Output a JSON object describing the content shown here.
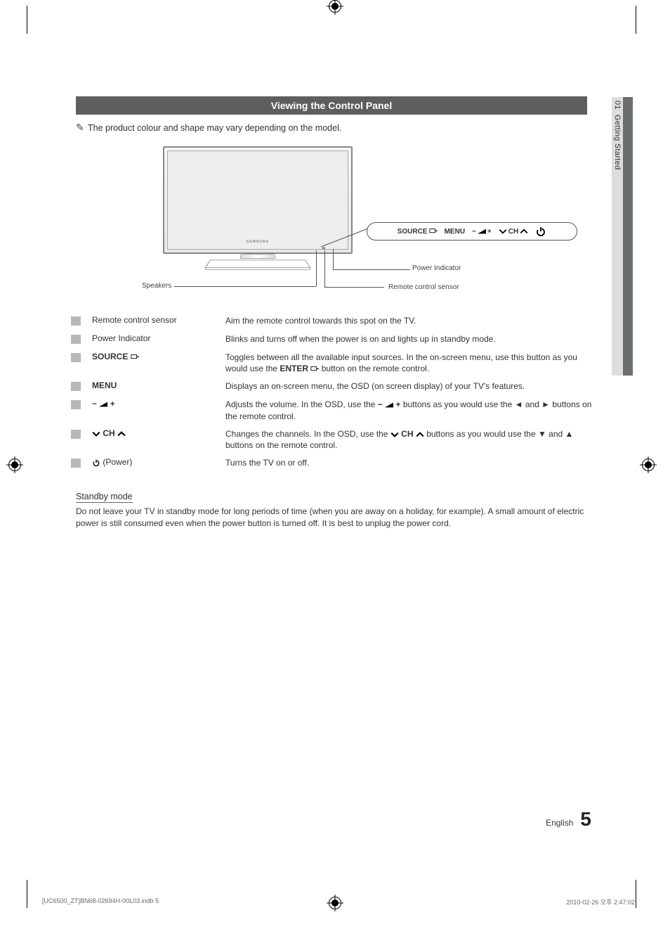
{
  "header": {
    "title": "Viewing the Control Panel"
  },
  "note": "The product colour and shape may vary depending on the model.",
  "diagram": {
    "logo": "SAMSUNG",
    "speakers_label": "Speakers",
    "power_ind_label": "Power Indicator",
    "remote_sensor_label": "Remote control sensor",
    "panel": {
      "source": "SOURCE",
      "menu": "MENU",
      "minus": "−",
      "plus": "+",
      "ch": "CH"
    }
  },
  "table": [
    {
      "name": "Remote control sensor",
      "desc": "Aim the remote control towards this spot on the TV."
    },
    {
      "name": "Power Indicator",
      "desc": "Blinks and turns off when the power is on and lights up in standby mode."
    },
    {
      "name": "SOURCE",
      "icon": "enter-icon",
      "desc_pre": "Toggles between all the available input sources. In the on-screen menu, use this button as you would use the ",
      "enter_word": "ENTER",
      "desc_post": " button on the remote control."
    },
    {
      "name": "MENU",
      "desc": "Displays an on-screen menu, the OSD (on screen display) of your TV's features."
    },
    {
      "name_icons": "volume",
      "desc_pre": "Adjusts the volume. In the OSD, use the ",
      "desc_post": " buttons as you would use the ◄ and ► buttons on the remote control."
    },
    {
      "name_icons": "channel",
      "desc_pre": "Changes the channels. In the OSD, use the ",
      "desc_post": " buttons as you would use the ▼ and ▲ buttons on the remote control."
    },
    {
      "name_icons": "power",
      "name_suffix": " (Power)",
      "desc": "Turns the TV on or off."
    }
  ],
  "standby": {
    "heading": "Standby mode",
    "body": "Do not leave your TV in standby mode for long periods of time (when you are away on a holiday, for example). A small amount of electric power is still consumed even when the power button is turned off. It is best to unplug the power cord."
  },
  "sidebar": {
    "num": "01",
    "label": "Getting Started"
  },
  "footer": {
    "lang": "English",
    "page": "5"
  },
  "print": {
    "left": "[UC6500_ZT]BN68-02694H-00L03.indb   5",
    "right": "2010-02-26   오후 2:47:02"
  }
}
